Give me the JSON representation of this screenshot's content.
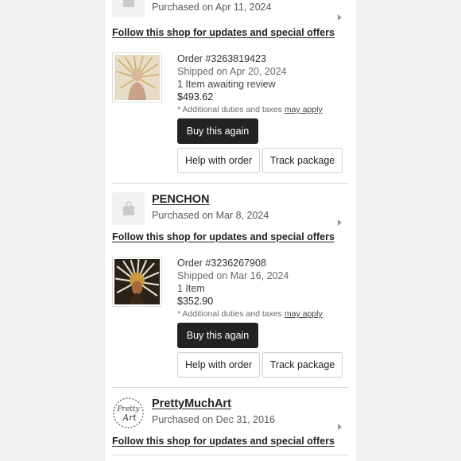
{
  "orders_list": {
    "top_group": {
      "purchased": "Purchased on Apr 11, 2024",
      "follow": "Follow this shop for updates and special offers",
      "order": {
        "order_number": "Order #3263819423",
        "shipped": "Shipped on Apr 20, 2024",
        "items": "1 Item awaiting review",
        "price": "$493.62",
        "duties_prefix": "* Additional duties and taxes",
        "duties_link": "may apply",
        "buy_again": "Buy this again",
        "help": "Help with order",
        "track": "Track package"
      }
    },
    "penchon_group": {
      "shop_name": "PENCHON",
      "purchased": "Purchased on Mar 8, 2024",
      "follow": "Follow this shop for updates and special offers",
      "order": {
        "order_number": "Order #3236267908",
        "shipped": "Shipped on Mar 16, 2024",
        "items": "1 Item",
        "price": "$352.90",
        "duties_prefix": "* Additional duties and taxes",
        "duties_link": "may apply",
        "buy_again": "Buy this again",
        "help": "Help with order",
        "track": "Track package"
      }
    },
    "prettymuchart_group": {
      "shop_name": "PrettyMuchArt",
      "logo_text_line1": "Pretty",
      "logo_text_line2": "Art",
      "purchased": "Purchased on Dec 31, 2016",
      "follow": "Follow this shop for updates and special offers"
    }
  },
  "icons": {
    "shop_placeholder": "shopping-bag-icon",
    "row_chevron": "chevron-right-icon"
  },
  "colors": {
    "primary_button": "#222222",
    "page_background": "#f1f1f1",
    "card_background": "#ffffff"
  }
}
